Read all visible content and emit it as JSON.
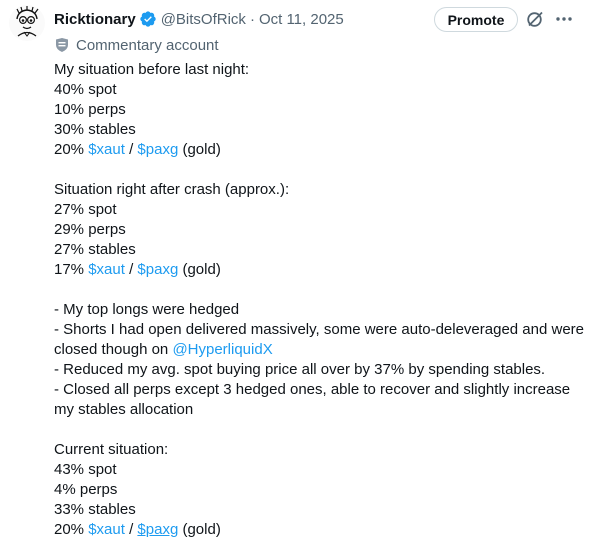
{
  "post": {
    "author": {
      "display_name": "Ricktionary",
      "handle": "@BitsOfRick",
      "separator": "·",
      "date": "Oct 11, 2025",
      "verified": true
    },
    "actions": {
      "promote_label": "Promote"
    },
    "label": "Commentary account",
    "icons": {
      "avatar": "cartoon-avatar",
      "verified": "verified-badge-icon",
      "grok": "grok-icon",
      "more": "more-icon",
      "label": "shield-icon"
    },
    "colors": {
      "link": "#1d9bf0",
      "secondary": "#536471",
      "verified": "#1d9bf0"
    },
    "sections": {
      "before": {
        "heading": "My situation before last night:",
        "spot": "40% spot",
        "perps": "10% perps",
        "stables": "30% stables",
        "gold": {
          "pct": "20% ",
          "xaut": "$xaut",
          "slash": " / ",
          "paxg": "$paxg",
          "suffix": " (gold)"
        }
      },
      "after": {
        "heading": "Situation right after crash (approx.):",
        "spot": "27% spot",
        "perps": "29% perps",
        "stables": "27% stables",
        "gold": {
          "pct": "17% ",
          "xaut": "$xaut",
          "slash": " / ",
          "paxg": "$paxg",
          "suffix": " (gold)"
        }
      },
      "notes": {
        "l1": "- My top longs were hedged",
        "l2_pre": "- Shorts I had open delivered massively, some were auto-deleveraged and were closed though on ",
        "l2_mention": "@HyperliquidX",
        "l3": "- Reduced my avg. spot buying price all over by 37% by spending stables.",
        "l4": "- Closed all perps except 3 hedged ones, able to recover and slightly increase my stables allocation"
      },
      "current": {
        "heading": "Current situation:",
        "spot": "43% spot",
        "perps": "4% perps",
        "stables": "33% stables",
        "gold": {
          "pct": "20% ",
          "xaut": "$xaut",
          "slash": " / ",
          "paxg": "$paxg",
          "suffix": " (gold)"
        }
      }
    }
  }
}
